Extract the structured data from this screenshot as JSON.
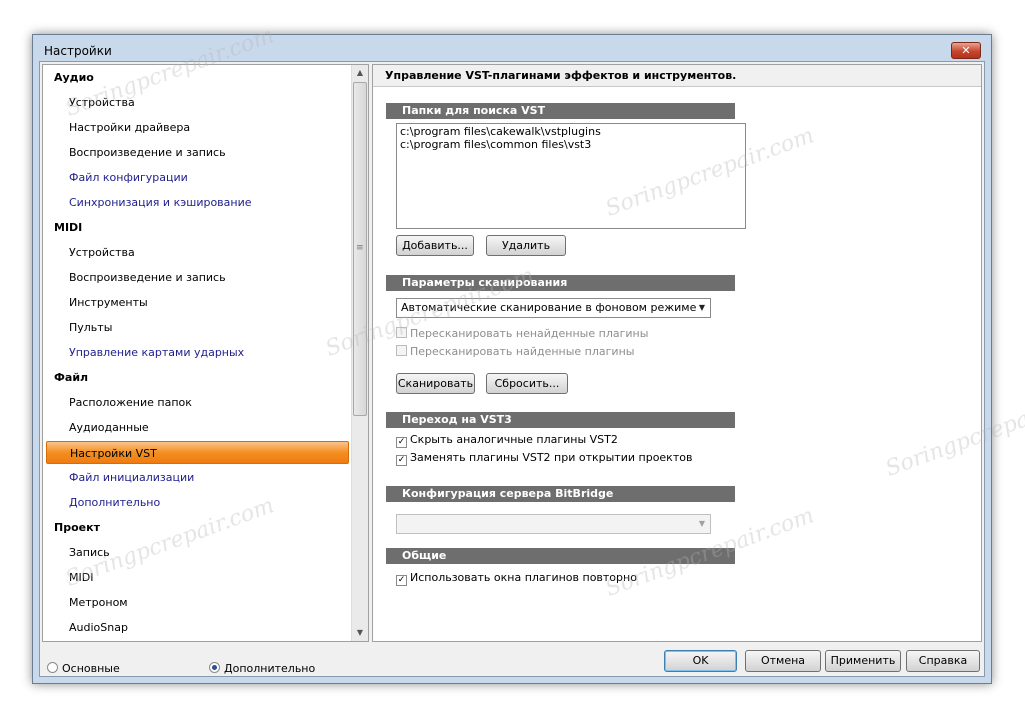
{
  "window": {
    "title": "Настройки",
    "close_glyph": "✕"
  },
  "tree": {
    "items": [
      {
        "label": "Аудио",
        "kind": "cat"
      },
      {
        "label": "Устройства",
        "kind": "sub"
      },
      {
        "label": "Настройки драйвера",
        "kind": "sub"
      },
      {
        "label": "Воспроизведение и запись",
        "kind": "sub"
      },
      {
        "label": "Файл конфигурации",
        "kind": "link"
      },
      {
        "label": "Синхронизация и кэширование",
        "kind": "link"
      },
      {
        "label": "MIDI",
        "kind": "cat"
      },
      {
        "label": "Устройства",
        "kind": "sub"
      },
      {
        "label": "Воспроизведение и запись",
        "kind": "sub"
      },
      {
        "label": "Инструменты",
        "kind": "sub"
      },
      {
        "label": "Пульты",
        "kind": "sub"
      },
      {
        "label": "Управление картами ударных",
        "kind": "link"
      },
      {
        "label": "Файл",
        "kind": "cat"
      },
      {
        "label": "Расположение папок",
        "kind": "sub"
      },
      {
        "label": "Аудиоданные",
        "kind": "sub"
      },
      {
        "label": "Настройки VST",
        "kind": "selected"
      },
      {
        "label": "Файл инициализации",
        "kind": "link"
      },
      {
        "label": "Дополнительно",
        "kind": "link"
      },
      {
        "label": "Проект",
        "kind": "cat"
      },
      {
        "label": "Запись",
        "kind": "sub"
      },
      {
        "label": "MIDI",
        "kind": "sub"
      },
      {
        "label": "Метроном",
        "kind": "sub"
      },
      {
        "label": "AudioSnap",
        "kind": "sub"
      }
    ],
    "scroll_up": "▲",
    "scroll_down": "▼",
    "grip": "≡"
  },
  "panel": {
    "header": "Управление VST-плагинами эффектов и инструментов.",
    "vst_folders": {
      "title": "Папки для поиска VST",
      "paths": [
        "c:\\program files\\cakewalk\\vstplugins",
        "c:\\program files\\common files\\vst3"
      ],
      "add_label": "Добавить...",
      "remove_label": "Удалить"
    },
    "scan_options": {
      "title": "Параметры сканирования",
      "mode": "Автоматические сканирование в фоновом режиме",
      "rescan_failed": {
        "label": "Пересканировать ненайденные плагины",
        "checked": false,
        "enabled": false
      },
      "rescan_existing": {
        "label": "Пересканировать найденные плагины",
        "checked": false,
        "enabled": false
      },
      "scan_label": "Сканировать",
      "reset_label": "Сбросить..."
    },
    "vst3_migration": {
      "title": "Переход на VST3",
      "hide_vst2": {
        "label": "Скрыть аналогичные плагины VST2",
        "checked": true
      },
      "replace_vst2": {
        "label": "Заменять плагины VST2 при открытии проектов",
        "checked": true
      }
    },
    "bitbridge": {
      "title": "Конфигурация сервера BitBridge",
      "value": ""
    },
    "general": {
      "title": "Общие",
      "reuse_windows": {
        "label": "Использовать окна плагинов повторно",
        "checked": true
      }
    }
  },
  "footer": {
    "basic_label": "Основные",
    "advanced_label": "Дополнительно",
    "selected": "advanced",
    "ok_label": "OK",
    "cancel_label": "Отмена",
    "apply_label": "Применить",
    "help_label": "Справка"
  },
  "watermark": {
    "text": "Soringpcrepair.com"
  },
  "icons": {
    "check": "✓",
    "dropdown": "▼"
  }
}
